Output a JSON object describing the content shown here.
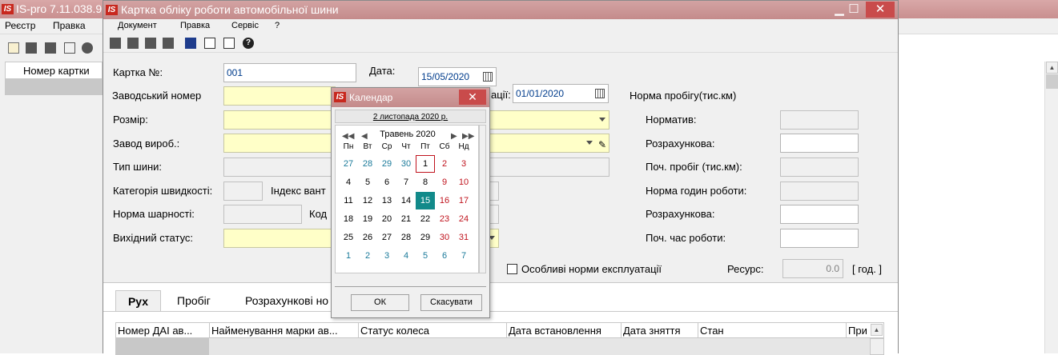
{
  "app": {
    "title": "IS-pro 7.11.038.9",
    "menu": [
      "Реєстр",
      "Правка"
    ],
    "grid_header": "Номер картки"
  },
  "dialog": {
    "title": "Картка обліку роботи автомобільної шини",
    "menu": [
      "Документ",
      "Правка",
      "Сервіс",
      "?"
    ],
    "fields": {
      "card_no_label": "Картка №:",
      "card_no_value": "001",
      "date_label": "Дата:",
      "date_value": "15/05/2020",
      "start_date_label_suffix": "ації:",
      "start_date_value": "01/01/2020",
      "factory_no_label": "Заводський номер",
      "size_label": "Розмір:",
      "manufacturer_label": "Завод вироб.:",
      "tyre_type_label": "Тип шини:",
      "speed_category_label": "Категорія швидкості:",
      "load_index_label": "Індекс вант",
      "hinge_norm_label": "Норма шарності:",
      "code_label": "Код",
      "output_status_label": "Вихідний статус:",
      "special_norms_label": "Особливі норми експлуатації",
      "resource_label": "Ресурс:",
      "resource_value": "0.0",
      "resource_unit": "[ год. ]"
    },
    "norms": {
      "header": "Норма пробігу(тис.км)",
      "normative_label": "Норматив:",
      "calculated1_label": "Розрахункова:",
      "start_mileage_label": "Поч. пробіг (тис.км):",
      "hours_norm_label": "Норма годин роботи:",
      "calculated2_label": "Розрахункова:",
      "start_hours_label": "Поч. час роботи:"
    },
    "tabs": [
      "Рух",
      "Пробіг",
      "Розрахункові но"
    ],
    "grid_columns": [
      "Номер ДАІ ав...",
      "Найменування марки ав...",
      "Статус колеса",
      "Дата встановлення",
      "Дата зняття",
      "Стан",
      "При"
    ]
  },
  "calendar": {
    "title": "Календар",
    "today_link": "2 листопада 2020 р.",
    "month_label": "Травень 2020",
    "weekdays": [
      "Пн",
      "Вт",
      "Ср",
      "Чт",
      "Пт",
      "Сб",
      "Нд"
    ],
    "weeks": [
      [
        "27",
        "28",
        "29",
        "30",
        "1",
        "2",
        "3"
      ],
      [
        "4",
        "5",
        "6",
        "7",
        "8",
        "9",
        "10"
      ],
      [
        "11",
        "12",
        "13",
        "14",
        "15",
        "16",
        "17"
      ],
      [
        "18",
        "19",
        "20",
        "21",
        "22",
        "23",
        "24"
      ],
      [
        "25",
        "26",
        "27",
        "28",
        "29",
        "30",
        "31"
      ],
      [
        "1",
        "2",
        "3",
        "4",
        "5",
        "6",
        "7"
      ]
    ],
    "selected_day": "15",
    "current_day": "1",
    "ok_label": "ОК",
    "cancel_label": "Скасувати",
    "colors": {
      "other_month": "#1a7a9a",
      "weekend": "#c0141e",
      "selected_bg": "#128a8a",
      "normal": "#000000"
    }
  }
}
